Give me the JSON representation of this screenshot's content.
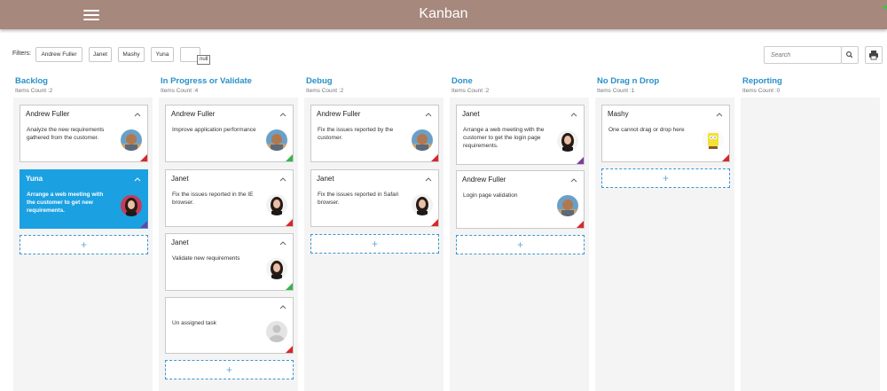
{
  "header": {
    "title": "Kanban",
    "menu_icon": "hamburger-menu-icon",
    "accent": "#a6887c"
  },
  "toolbar": {
    "filters_label": "Filters:",
    "filters": [
      "Andrew Fuller",
      "Janet",
      "Mashy",
      "Yuna",
      ""
    ],
    "tooltip": "null",
    "search_placeholder": "Search",
    "search_icon": "search-icon",
    "print_icon": "print-icon"
  },
  "colors": {
    "title": "#2891c8",
    "selected": "#1ba1e2",
    "red": "#d9262b",
    "green": "#37b34a",
    "purple": "#7b3f9e"
  },
  "columns": [
    {
      "title": "Backlog",
      "count": "Items Count :2",
      "cards": [
        {
          "name": "Andrew Fuller",
          "text": "Analyze the new requirements gathered from the customer.",
          "avatar": "man",
          "corner": "red"
        },
        {
          "name": "Yuna",
          "text": "Arrange a web meeting with the customer to get new requirements.",
          "avatar": "woman-red",
          "corner": "purple",
          "selected": true
        }
      ]
    },
    {
      "title": "In Progress or Validate",
      "count": "Items Count :4",
      "cards": [
        {
          "name": "Andrew Fuller",
          "text": "Improve application performance",
          "avatar": "man",
          "corner": "green"
        },
        {
          "name": "Janet",
          "text": "Fix the issues reported in the IE browser.",
          "avatar": "woman",
          "corner": "red"
        },
        {
          "name": "Janet",
          "text": "Validate new requirements",
          "avatar": "woman",
          "corner": "green"
        },
        {
          "name": "",
          "text": "Un assigned task",
          "avatar": "placeholder",
          "corner": "red"
        }
      ]
    },
    {
      "title": "Debug",
      "count": "Items Count :2",
      "cards": [
        {
          "name": "Andrew Fuller",
          "text": "Fix the issues reported by the customer.",
          "avatar": "man",
          "corner": "red"
        },
        {
          "name": "Janet",
          "text": "Fix the issues reported in Safari browser.",
          "avatar": "woman",
          "corner": "red"
        }
      ]
    },
    {
      "title": "Done",
      "count": "Items Count :2",
      "cards": [
        {
          "name": "Janet",
          "text": "Arrange a web meeting with the customer to get the login page requirements.",
          "avatar": "woman",
          "corner": "purple"
        },
        {
          "name": "Andrew Fuller",
          "text": "Login page validation",
          "avatar": "man",
          "corner": "red"
        }
      ]
    },
    {
      "title": "No Drag n Drop",
      "count": "Items Count :1",
      "cards": [
        {
          "name": "Mashy",
          "text": "One cannot drag or drop here",
          "avatar": "sponge",
          "corner": "red"
        }
      ]
    },
    {
      "title": "Reporting",
      "count": "Items Count :0",
      "cards": []
    }
  ]
}
